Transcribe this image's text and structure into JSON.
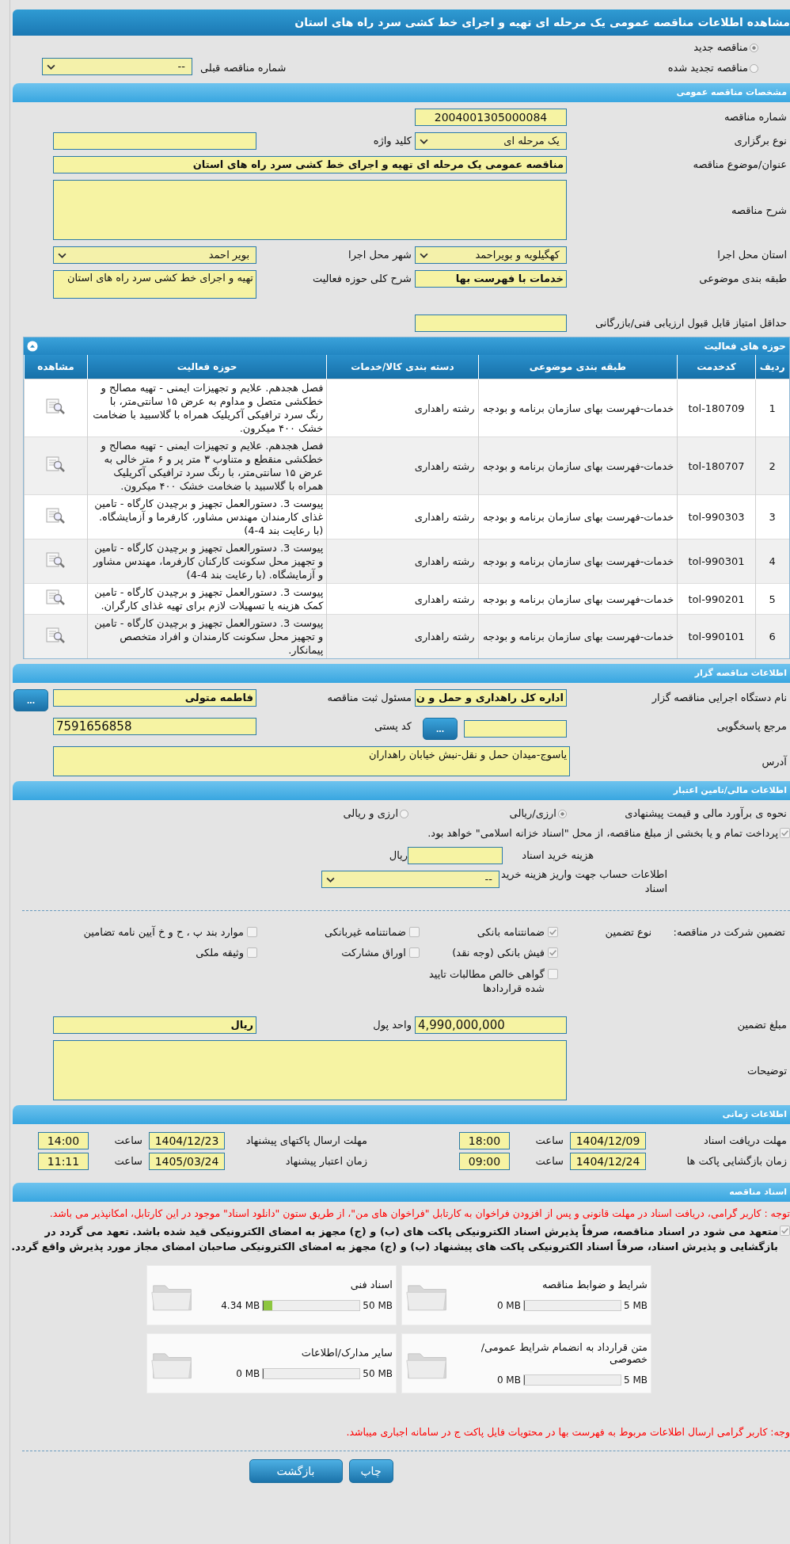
{
  "window": {
    "title": "مشاهده اطلاعات مناقصه عمومی یک مرحله ای تهیه و اجرای خط کشی سرد راه های استان"
  },
  "tender_type": [
    {
      "label": "مناقصه جدید",
      "selected": true
    },
    {
      "label": "مناقصه تجدید شده",
      "selected": false
    }
  ],
  "previous_tender": {
    "label": "شماره مناقصه قبلی",
    "value": "--"
  },
  "general": {
    "title": "مشخصات مناقصه عمومی",
    "tender_number": {
      "label": "شماره مناقصه",
      "value": "2004001305000084"
    },
    "holding_type": {
      "label": "نوع برگزاری",
      "value": "یک مرحله ای"
    },
    "keyword": {
      "label": "کلید واژه"
    },
    "subject": {
      "label": "عنوان/موضوع مناقصه",
      "value": "مناقصه عمومی یک مرحله ای تهیه و اجرای خط کشی سرد راه های استان"
    },
    "description": {
      "label": "شرح مناقصه"
    },
    "province": {
      "label": "استان محل اجرا",
      "value": "کهگیلویه و بویراحمد"
    },
    "city": {
      "label": "شهر محل اجرا",
      "value": "بویر احمد"
    },
    "category": {
      "label": "طبقه بندی موضوعی",
      "value": "خدمات با فهرست بها"
    },
    "scope": {
      "label": "شرح کلی حوزه فعالیت",
      "value": "تهیه و اجرای خط کشی سرد راه های استان"
    },
    "min_score": {
      "label": "حداقل امتیاز قابل قبول ارزیابی فنی/بازرگانی"
    }
  },
  "activities": {
    "title": "حوزه های فعالیت",
    "expanded": true,
    "columns": [
      "ردیف",
      "کدخدمت",
      "طبقه بندی موضوعی",
      "دسته بندی کالا/خدمات",
      "حوزه فعالیت",
      "مشاهده"
    ],
    "rows": [
      {
        "row": "1",
        "code": "tol-180709",
        "category": "خدمات-فهرست بهای سازمان برنامه و بودجه",
        "group": "رشته راهداری",
        "activity": "فصل هجدهم. علایم و تجهیزات ایمنی - تهیه مصالح و خطکشی متصل و مداوم به عرض ۱۵ سانتی‌متر، با رنگ سرد ترافیکی آکریلیک همراه با گلاسبید با ضخامت خشک ۴۰۰ میکرون."
      },
      {
        "row": "2",
        "code": "tol-180707",
        "category": "خدمات-فهرست بهای سازمان برنامه و بودجه",
        "group": "رشته راهداری",
        "activity": "فصل هجدهم. علایم و تجهیزات ایمنی - تهیه مصالح و خطکشی منقطع و متناوب ۳ متر پر و ۶ متر خالی به عرض ۱۵ سانتی‌متر، با رنگ سرد ترافیکی آکریلیک همراه با گلاسبید با ضخامت خشک ۴۰۰ میکرون."
      },
      {
        "row": "3",
        "code": "tol-990303",
        "category": "خدمات-فهرست بهای سازمان برنامه و بودجه",
        "group": "رشته راهداری",
        "activity": "پیوست 3. دستورالعمل تجهیز و برچیدن کارگاه - تامین غذای کارمندان مهندس مشاور، کارفرما و آزمایشگاه. (با رعایت بند 4-4)"
      },
      {
        "row": "4",
        "code": "tol-990301",
        "category": "خدمات-فهرست بهای سازمان برنامه و بودجه",
        "group": "رشته راهداری",
        "activity": "پیوست 3. دستورالعمل تجهیز و برچیدن کارگاه - تامین و تجهیز محل سکونت کارکنان کارفرما، مهندس مشاور و آزمایشگاه. (با رعایت بند 4-4)"
      },
      {
        "row": "5",
        "code": "tol-990201",
        "category": "خدمات-فهرست بهای سازمان برنامه و بودجه",
        "group": "رشته راهداری",
        "activity": "پیوست 3. دستورالعمل تجهیز و برچیدن کارگاه - تامین کمک هزینه یا تسهیلات لازم برای تهیه غذای کارگران."
      },
      {
        "row": "6",
        "code": "tol-990101",
        "category": "خدمات-فهرست بهای سازمان برنامه و بودجه",
        "group": "رشته راهداری",
        "activity": "پیوست 3. دستورالعمل تجهیز و برچیدن کارگاه - تامین و تجهیز محل سکونت کارمندان و افراد متخصص پیمانکار."
      }
    ]
  },
  "contractor": {
    "title": "اطلاعات مناقصه گزار",
    "organization": {
      "label": "نام دستگاه اجرایی مناقصه گزار",
      "value": "اداره کل راهداری و حمل و ن"
    },
    "registrar": {
      "label": "مسئول ثبت مناقصه",
      "value": "فاطمه متولی",
      "button": "..."
    },
    "reference": {
      "label": "مرجع پاسخگویی",
      "button": "..."
    },
    "postal_code": {
      "label": "کد پستی",
      "value": "7591656858"
    },
    "address": {
      "label": "آدرس",
      "value": "یاسوج-میدان حمل و نقل-نبش خیابان راهداران"
    }
  },
  "financial": {
    "title": "اطلاعات مالی/تامین اعتبار",
    "estimate": {
      "label": "نحوه ی برآورد مالی و قیمت پیشنهادی",
      "options": [
        {
          "label": "ارزی/ریالی",
          "selected": true
        },
        {
          "label": "ارزی و ریالی",
          "selected": false
        }
      ]
    },
    "treasury": {
      "checked": true,
      "text": "پرداخت تمام و یا بخشی از مبلغ مناقصه، از محل \"اسناد خزانه اسلامی\" خواهد بود."
    },
    "fee": {
      "label": "هزینه خرید اسناد",
      "unit": "ریال"
    },
    "account": {
      "label": "اطلاعات حساب جهت واریز هزینه خرید اسناد",
      "value": "--"
    }
  },
  "guarantee": {
    "label": "تضمین شرکت در مناقصه:",
    "type_label": "نوع تضمین",
    "options": [
      {
        "label": "ضمانتنامه بانکی",
        "checked": true
      },
      {
        "label": "ضمانتنامه غیربانکی",
        "checked": false
      },
      {
        "label": "موارد بند پ ، ح و خ آیین نامه تضامین",
        "checked": false
      },
      {
        "label": "فیش بانکی (وجه نقد)",
        "checked": true
      },
      {
        "label": "اوراق مشارکت",
        "checked": false
      },
      {
        "label": "وثیقه ملکی",
        "checked": false
      },
      {
        "label": "گواهی خالص مطالبات تایید شده قراردادها",
        "checked": false
      }
    ],
    "amount": {
      "label": "مبلغ تضمین",
      "value": "4,990,000,000"
    },
    "currency": {
      "label": "واحد پول",
      "value": "ریال"
    },
    "notes": {
      "label": "توضیحات"
    }
  },
  "timing": {
    "title": "اطلاعات زمانی",
    "items": [
      {
        "label": "مهلت دریافت اسناد",
        "date": "1404/12/09",
        "time_label": "ساعت",
        "time": "18:00"
      },
      {
        "label": "مهلت ارسال پاکتهای پیشنهاد",
        "date": "1404/12/23",
        "time_label": "ساعت",
        "time": "14:00"
      },
      {
        "label": "زمان بازگشایی پاکت ها",
        "date": "1404/12/24",
        "time_label": "ساعت",
        "time": "09:00"
      },
      {
        "label": "زمان اعتبار پیشنهاد",
        "date": "1405/03/24",
        "time_label": "ساعت",
        "time": "11:11"
      }
    ]
  },
  "documents": {
    "title": "اسناد مناقصه",
    "notice": "توجه : کاربر گرامی، دریافت اسناد در مهلت قانونی و پس از افزودن فراخوان به کارتابل \"فراخوان های من\"، از طریق ستون \"دانلود اسناد\" موجود در این کارتابل، امکانپذیر می باشد.",
    "commitment": {
      "checked": true,
      "text": "متعهد می شود در اسناد مناقصه، صرفاً پذیرش اسناد الکترونیکی پاکت های (ب) و (ج) مجهز به امضای الکترونیکی قید شده باشد. تعهد می گردد در بازگشایی و پذیرش اسناد، صرفاً اسناد الکترونیکی پاکت های پیشنهاد (ب) و (ج) مجهز به امضای الکترونیکی صاحبان امضای مجاز مورد پذیرش واقع گردد."
    },
    "files": [
      {
        "name": "شرایط و ضوابط مناقصه",
        "used": "0 MB",
        "limit": "5 MB",
        "level": 0
      },
      {
        "name": "اسناد فنی",
        "used": "4.34 MB",
        "limit": "50 MB",
        "level": 0.087
      },
      {
        "name": "متن قرارداد به انضمام شرایط عمومی/خصوصی",
        "used": "0 MB",
        "limit": "5 MB",
        "level": 0
      },
      {
        "name": "سایر مدارک/اطلاعات",
        "used": "0 MB",
        "limit": "50 MB",
        "level": 0
      }
    ],
    "footer_notice": "وجه: کاربر گرامی ارسال اطلاعات مربوط به فهرست بها در محتویات فایل پاکت ج در سامانه اجباری میباشد."
  },
  "buttons": [
    {
      "label": "چاپ"
    },
    {
      "label": "بازگشت"
    }
  ]
}
